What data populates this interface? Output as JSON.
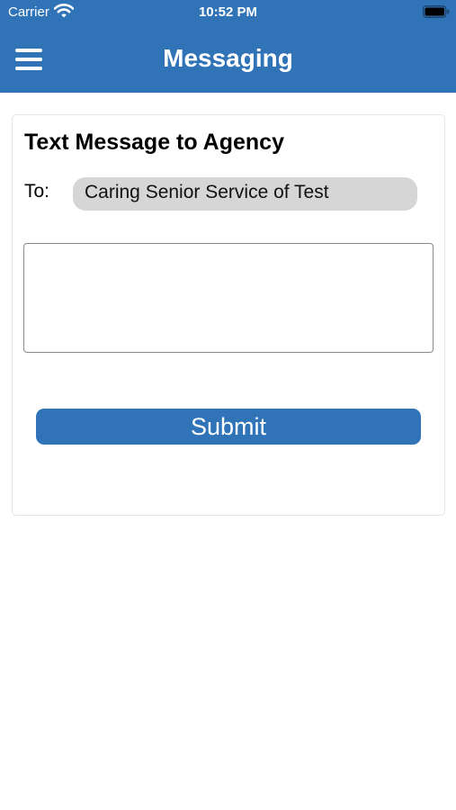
{
  "status_bar": {
    "carrier": "Carrier",
    "time": "10:52 PM",
    "icons": [
      "wifi-icon",
      "battery-icon"
    ]
  },
  "nav": {
    "title": "Messaging",
    "menu_icon": "hamburger-menu-icon"
  },
  "form": {
    "title": "Text Message to Agency",
    "to_label": "To:",
    "recipient": "Caring Senior Service of Test",
    "message_value": "",
    "message_placeholder": "",
    "submit_label": "Submit"
  },
  "colors": {
    "header": "#3074b7",
    "button": "#3074b7",
    "recipient_bg": "#d6d6d6"
  }
}
